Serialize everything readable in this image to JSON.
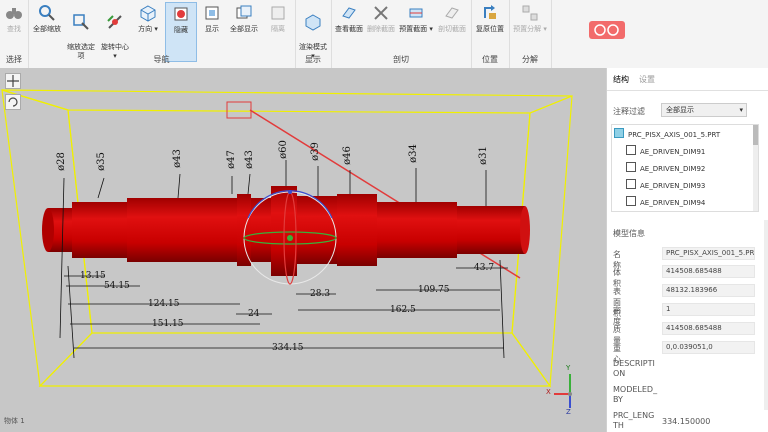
{
  "ribbon": {
    "groups": [
      {
        "label": "选择",
        "buttons": [
          {
            "label": "查找",
            "icon": "binoculars-icon",
            "disabled": true
          }
        ]
      },
      {
        "label": "导航",
        "buttons": [
          {
            "label": "全部缩放",
            "icon": "zoom-all-icon"
          },
          {
            "label": "缩放选定\n项",
            "icon": "zoom-selected-icon"
          },
          {
            "label": "旋转中心\n▾",
            "icon": "rotation-center-icon"
          },
          {
            "label": "方向 ▾",
            "icon": "orientation-cube-icon"
          },
          {
            "label": "隐藏",
            "icon": "hide-icon",
            "selected": true
          },
          {
            "label": "显示",
            "icon": "show-icon"
          },
          {
            "label": "全部显示",
            "icon": "show-all-icon"
          },
          {
            "label": "隔离",
            "icon": "isolate-icon",
            "disabled": true
          }
        ]
      },
      {
        "label": "显示",
        "buttons": [
          {
            "label": "渲染模式\n▾",
            "icon": "render-mode-icon"
          }
        ]
      },
      {
        "label": "剖切",
        "buttons": [
          {
            "label": "查看截面",
            "icon": "view-section-icon"
          },
          {
            "label": "删除截面",
            "icon": "delete-section-icon",
            "disabled": true
          },
          {
            "label": "预置截面 ▾",
            "icon": "preset-section-icon"
          },
          {
            "label": "剖切截面",
            "icon": "cut-section-icon",
            "disabled": true
          }
        ]
      },
      {
        "label": "位置",
        "buttons": [
          {
            "label": "复原位置",
            "icon": "restore-position-icon"
          }
        ]
      },
      {
        "label": "分解",
        "buttons": [
          {
            "label": "预置分解 ▾",
            "icon": "preset-explode-icon",
            "disabled": true
          }
        ]
      }
    ]
  },
  "viewport": {
    "dimensions": [
      "ø28",
      "ø35",
      "ø43",
      "ø47",
      "ø43",
      "ø60",
      "ø39",
      "ø46",
      "ø34",
      "ø31"
    ],
    "lengths": [
      "13.15",
      "54.15",
      "124.15",
      "151.15",
      "24",
      "28.3",
      "162.5",
      "109.75",
      "43.7",
      "334.15"
    ],
    "status": "物体 1",
    "axes": {
      "x": "X",
      "y": "Y",
      "z": "Z"
    }
  },
  "panel": {
    "tabs": [
      "结构",
      "设置"
    ],
    "filter_label": "注释过滤",
    "filter_value": "全部显示",
    "tree": [
      "PRC_PISX_AXIS_001_5.PRT",
      "AE_DRIVEN_DIM91",
      "AE_DRIVEN_DIM92",
      "AE_DRIVEN_DIM93",
      "AE_DRIVEN_DIM94"
    ],
    "model_info_title": "模型信息",
    "props": [
      {
        "label": "名称",
        "value": "PRC_PISX_AXIS_001_5.PRT"
      },
      {
        "label": "体积",
        "value": "414508.685488"
      },
      {
        "label": "表面积",
        "value": "48132.183966"
      },
      {
        "label": "密度",
        "value": "1"
      },
      {
        "label": "质量",
        "value": "414508.685488"
      },
      {
        "label": "重心",
        "value": "0,0.039051,0"
      }
    ],
    "extra": [
      {
        "label": "DESCRIPTI\nON",
        "value": ""
      },
      {
        "label": "MODELED_\nBY",
        "value": ""
      },
      {
        "label": "PRC_LENG\nTH",
        "value": "334.150000"
      }
    ]
  },
  "colors": {
    "shaft": "#c80000",
    "bbox": "#f0f000",
    "accent": "#e84a4a"
  }
}
